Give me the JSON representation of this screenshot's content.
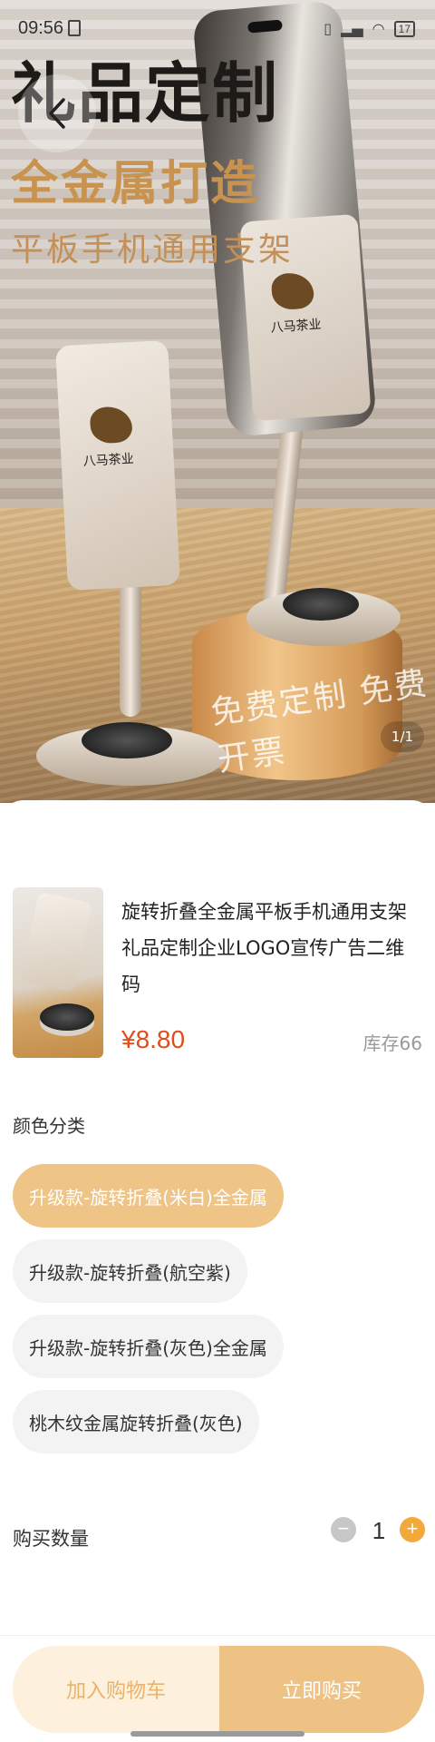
{
  "status_bar": {
    "time": "09:56",
    "battery": "17"
  },
  "product_image": {
    "title": "礼品定制",
    "subtitle": "全金属打造",
    "subtitle2": "平板手机通用支架",
    "footer_text": "免费定制 免费开票",
    "logo_text": "八马茶业",
    "pager": "1/1"
  },
  "product": {
    "title": "旋转折叠全金属平板手机通用支架礼品定制企业LOGO宣传广告二维码",
    "price": "¥8.80",
    "stock": "库存66"
  },
  "color_section": {
    "title": "颜色分类",
    "options": [
      "升级款-旋转折叠(米白)全金属",
      "升级款-旋转折叠(航空紫)",
      "升级款-旋转折叠(灰色)全金属",
      "桃木纹金属旋转折叠(灰色)"
    ],
    "selected_index": 0
  },
  "quantity": {
    "label": "购买数量",
    "value": "1",
    "minus": "−",
    "plus": "+"
  },
  "actions": {
    "add_to_cart": "加入购物车",
    "buy_now": "立即购买"
  },
  "colors": {
    "accent": "#f0a93a",
    "selected_option": "#eec487",
    "price": "#e04d1b",
    "cart_bg": "#fdf0dc",
    "buy_bg": "#eec285"
  }
}
